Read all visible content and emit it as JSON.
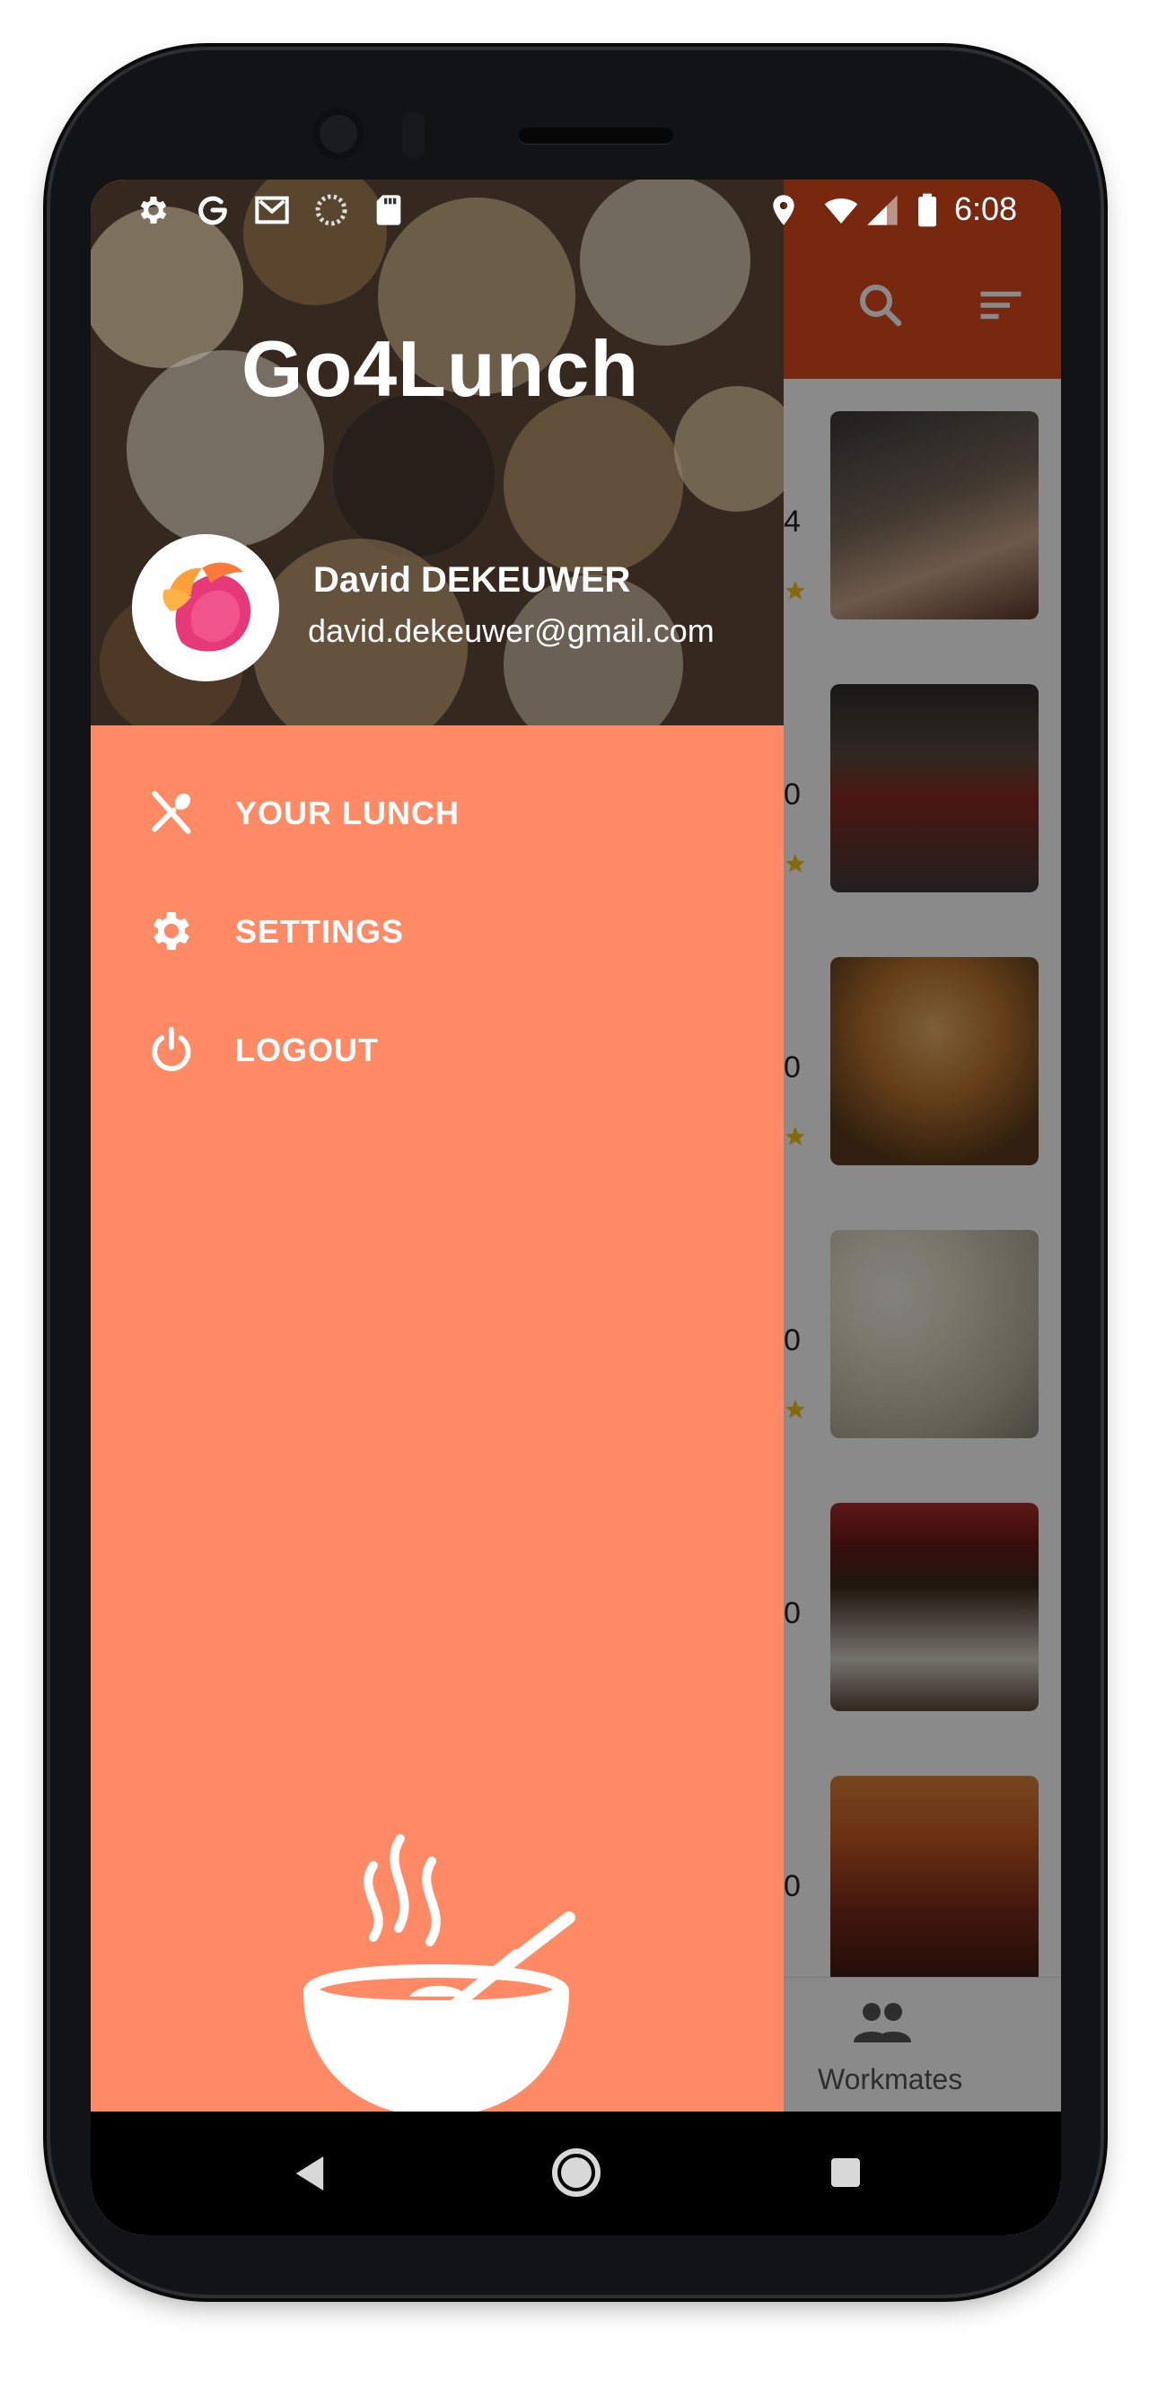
{
  "status_bar": {
    "time": "6:08",
    "left_icons": [
      "settings-icon",
      "google-icon",
      "gmail-icon",
      "sync-icon",
      "sd-card-icon"
    ],
    "right_icons": [
      "location-icon",
      "wifi-icon",
      "signal-icon",
      "battery-icon"
    ]
  },
  "toolbar": {
    "icons": [
      "search-icon",
      "sort-icon"
    ],
    "color": "#dc4a1c"
  },
  "restaurant_list": {
    "partial_values": [
      "4",
      "0",
      "0",
      "0",
      "0",
      "0"
    ]
  },
  "bottom_nav": {
    "workmates_label": "Workmates"
  },
  "drawer": {
    "app_title": "Go4Lunch",
    "user": {
      "name": "David DEKEUWER",
      "email": "david.dekeuwer@gmail.com"
    },
    "menu": [
      {
        "label": "YOUR LUNCH",
        "icon": "fork-knife-icon"
      },
      {
        "label": "SETTINGS",
        "icon": "gear-icon"
      },
      {
        "label": "LOGOUT",
        "icon": "power-icon"
      }
    ],
    "background_color": "#ff8a65"
  },
  "navigation_bar": {
    "buttons": [
      "back-icon",
      "home-icon",
      "recents-icon"
    ]
  }
}
